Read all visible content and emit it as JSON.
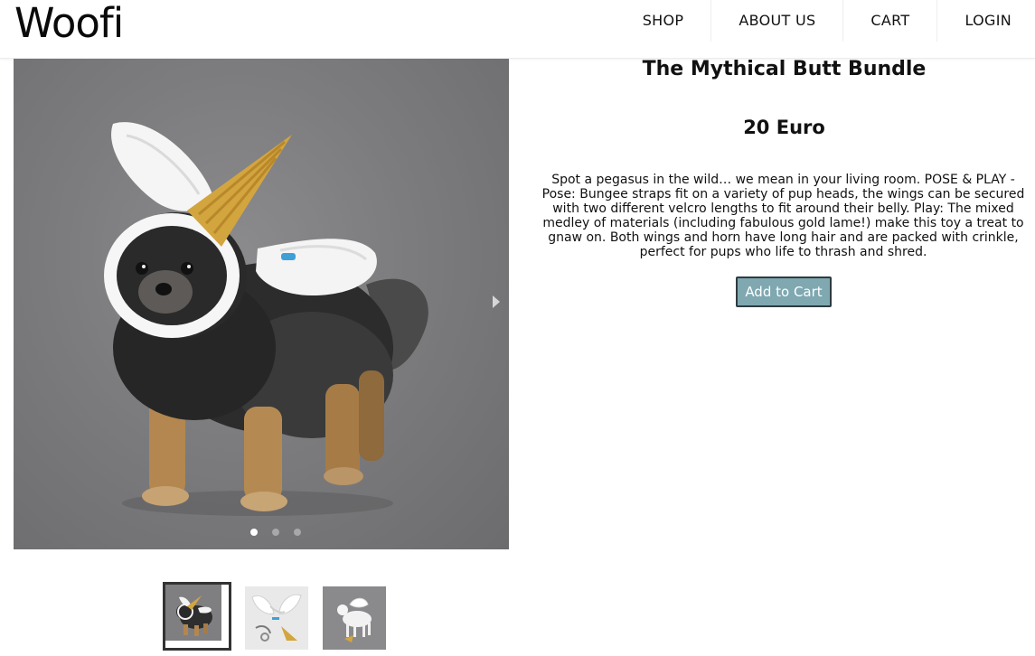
{
  "brand": {
    "logo_text": "Woofi"
  },
  "nav": {
    "items": [
      {
        "label": "SHOP"
      },
      {
        "label": "ABOUT US"
      },
      {
        "label": "CART"
      },
      {
        "label": "LOGIN"
      }
    ]
  },
  "product": {
    "title": "The Mythical Butt Bundle",
    "price": "20 Euro",
    "description": "Spot a pegasus in the wild… we mean in your living room. POSE & PLAY - Pose: Bungee straps fit on a variety of pup heads, the wings can be secured with two different velcro lengths to fit around their belly. Play: The mixed medley of materials (including fabulous gold lame!) make this toy a treat to gnaw on. Both wings and horn have long hair and are packed with crinkle, perfect for pups who life to thrash and shred.",
    "add_to_cart_label": "Add to Cart"
  },
  "carousel": {
    "slide_count": 3,
    "active_index": 0,
    "next_icon": "chevron-right-icon"
  },
  "thumbnails": {
    "selected_index": 0,
    "items": [
      {
        "image": "dog-with-wings-and-horn"
      },
      {
        "image": "wings-and-horn-set"
      },
      {
        "image": "white-dog-with-wings"
      }
    ]
  },
  "colors": {
    "button_bg": "#7fa8b1",
    "button_border": "#2f3b3f",
    "photo_background": "#7c7c7e"
  }
}
